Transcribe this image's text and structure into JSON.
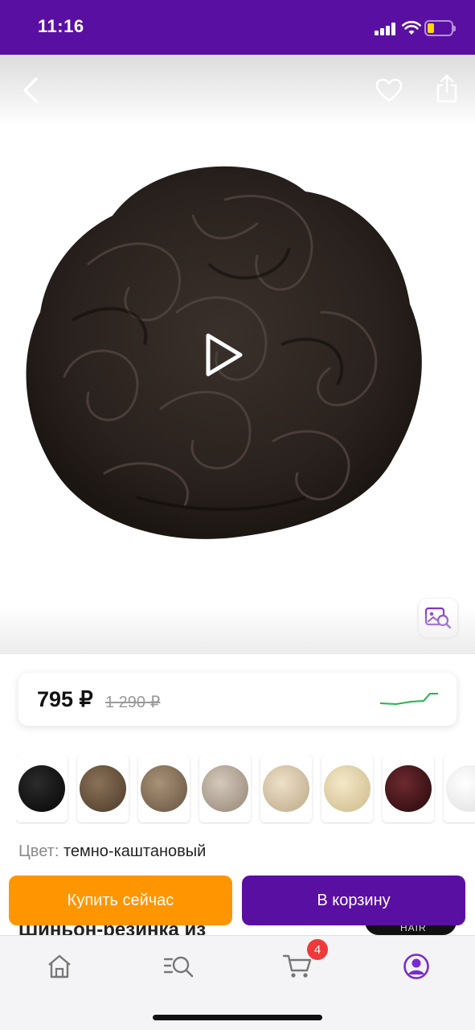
{
  "status_bar": {
    "time": "11:16"
  },
  "product": {
    "price": {
      "current": "795 ₽",
      "old": "1 290 ₽"
    },
    "swatches": [
      {
        "color": "#111111",
        "highlight": "#2b2b2b"
      },
      {
        "color": "#5e4a36",
        "highlight": "#8a7258"
      },
      {
        "color": "#7a6650",
        "highlight": "#a89278"
      },
      {
        "color": "#a7998a",
        "highlight": "#d4c9bb"
      },
      {
        "color": "#cbb89a",
        "highlight": "#ece0c8"
      },
      {
        "color": "#d9c79c",
        "highlight": "#f3e8c8"
      },
      {
        "color": "#3a1216",
        "highlight": "#6e2a2f"
      },
      {
        "color": "#e8e8e8",
        "highlight": "#ffffff"
      }
    ],
    "color_label": "Цвет:",
    "color_value": "темно-каштановый",
    "title": "Шиньон-резинка из",
    "brand_badge": "HAIR"
  },
  "actions": {
    "buy_now": "Купить сейчас",
    "add_to_cart": "В корзину"
  },
  "tab_bar": {
    "items": [
      {
        "icon": "home-icon",
        "active": false
      },
      {
        "icon": "catalog-search-icon",
        "active": false
      },
      {
        "icon": "cart-icon",
        "active": false
      },
      {
        "icon": "profile-icon",
        "active": true
      }
    ],
    "cart_count": "4"
  },
  "colors": {
    "brand_purple": "#5a0fa3",
    "buy_orange": "#ff9500",
    "trend_green": "#1fb84a",
    "badge_red": "#ee3a3a"
  }
}
